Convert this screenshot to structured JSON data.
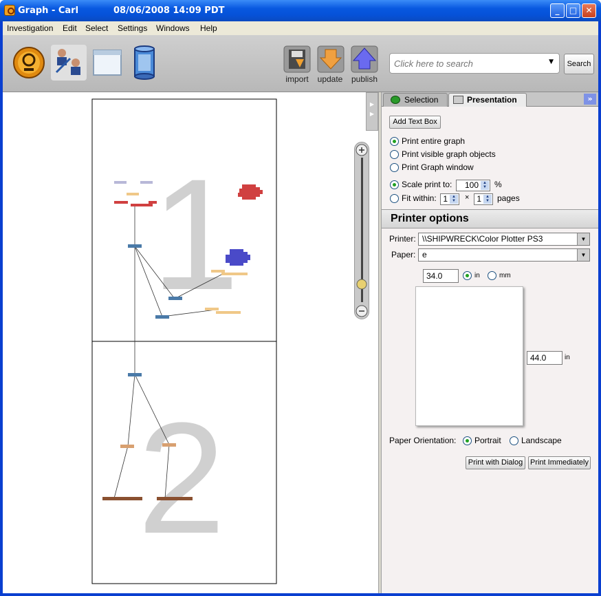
{
  "window": {
    "title": "Graph - Carl",
    "datetime": "08/06/2008 14:09 PDT",
    "controls": {
      "minimize": "_",
      "maximize": "□",
      "close": "✕"
    }
  },
  "menu": [
    "Investigation",
    "Edit",
    "Select",
    "Settings",
    "Windows",
    "Help"
  ],
  "toolbar": {
    "tools": [
      "logo-tool",
      "graph-tool",
      "window-tool",
      "database-tool"
    ],
    "import_label": "import",
    "update_label": "update",
    "publish_label": "publish",
    "search_placeholder": "Click here to search",
    "search_button": "Search"
  },
  "graph": {
    "page_numbers": [
      "1",
      "2"
    ],
    "colors": {
      "red": "#d04040",
      "blue": "#4a7aa8",
      "violet": "#4a4ac8",
      "peach": "#f0c888",
      "orange": "#d8a070",
      "brown": "#8a5030",
      "lavender": "#b8b8d8",
      "watermark": "#d0d0d0"
    }
  },
  "panel": {
    "tabs": {
      "selection": "Selection",
      "presentation": "Presentation"
    },
    "add_text_box": "Add Text Box",
    "print_scope": [
      {
        "label": "Print entire graph",
        "selected": true
      },
      {
        "label": "Print visible graph objects",
        "selected": false
      },
      {
        "label": "Print Graph window",
        "selected": false
      }
    ],
    "scale": {
      "label": "Scale print to:",
      "value": "100",
      "unit": "%",
      "selected": true
    },
    "fit": {
      "label": "Fit within:",
      "across": "1",
      "times": "×",
      "down": "1",
      "unit": "pages",
      "selected": false
    },
    "printer_options_title": "Printer options",
    "printer_label": "Printer:",
    "printer_value": "\\\\SHIPWRECK\\Color Plotter PS3",
    "paper_label": "Paper:",
    "paper_value": "e",
    "width_value": "34.0",
    "height_value": "44.0",
    "unit_in": "in",
    "unit_mm": "mm",
    "unit_selected": "in",
    "orientation_label": "Paper Orientation:",
    "portrait": "Portrait",
    "landscape": "Landscape",
    "orientation_selected": "Portrait",
    "print_with_dialog": "Print with Dialog",
    "print_immediately": "Print Immediately"
  }
}
